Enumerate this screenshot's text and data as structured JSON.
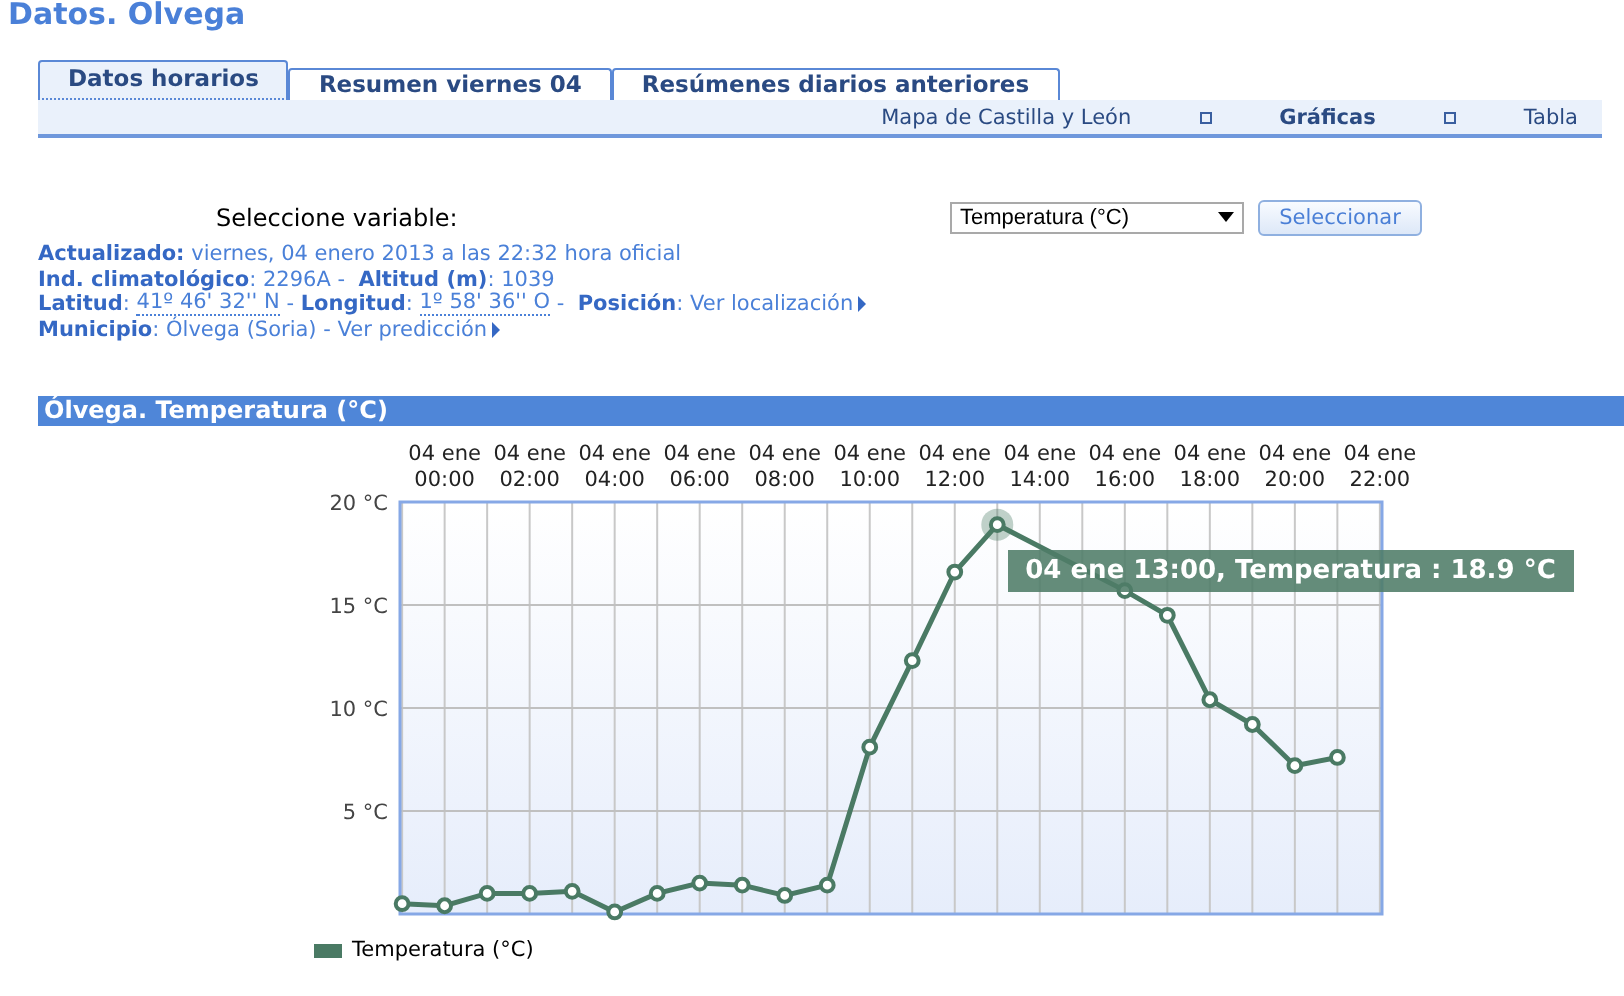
{
  "page_title": "Datos. Olvega",
  "tabs": [
    {
      "label": "Datos horarios",
      "selected": true
    },
    {
      "label": "Resumen viernes 04",
      "selected": false
    },
    {
      "label": "Resúmenes diarios anteriores",
      "selected": false
    }
  ],
  "subnav": [
    {
      "label": "Mapa de Castilla y León",
      "selected": false
    },
    {
      "label": "Gráficas",
      "selected": true
    },
    {
      "label": "Tabla",
      "selected": false
    }
  ],
  "variable_selector": {
    "label": "Seleccione variable:",
    "value": "Temperatura (°C)",
    "button": "Seleccionar"
  },
  "info_lines": [
    [
      {
        "kind": "text",
        "text": "**Actualizado:** viernes, 04 enero 2013 a las 22:32 hora oficial"
      }
    ],
    [
      {
        "kind": "text",
        "text": "**Ind. climatológico**: 2296A -  **Altitud (m)**: 1039"
      }
    ],
    [
      {
        "kind": "text",
        "text": "**Latitud**: "
      },
      {
        "kind": "dotted",
        "text": "41º 46' 32'' N"
      },
      {
        "kind": "text",
        "text": " - **Longitud**: "
      },
      {
        "kind": "dotted",
        "text": "1º 58' 36'' O"
      },
      {
        "kind": "text",
        "text": " -  **Posición**: "
      },
      {
        "kind": "link",
        "text": "Ver localización"
      }
    ],
    [
      {
        "kind": "text",
        "text": "**Municipio**: Ólvega (Soria) - "
      },
      {
        "kind": "link",
        "text": "Ver predicción"
      }
    ]
  ],
  "section_title": "Ólvega. Temperatura (°C)",
  "chart_data": {
    "type": "line",
    "categories": [
      null,
      "04 ene 00:00",
      null,
      "04 ene 02:00",
      null,
      "04 ene 04:00",
      null,
      "04 ene 06:00",
      null,
      "04 ene 08:00",
      null,
      "04 ene 10:00",
      null,
      "04 ene 12:00",
      null,
      "04 ene 14:00",
      null,
      "04 ene 16:00",
      null,
      "04 ene 18:00",
      null,
      "04 ene 20:00",
      null,
      "04 ene 22:00"
    ],
    "series": [
      {
        "name": "Temperatura (°C)",
        "color": "#4a7a64",
        "marker": "circle",
        "values": [
          0.5,
          0.4,
          1.0,
          1.0,
          1.1,
          0.1,
          1.0,
          1.5,
          1.4,
          0.9,
          1.4,
          8.1,
          12.3,
          16.6,
          18.9,
          null,
          null,
          15.7,
          14.5,
          10.4,
          9.2,
          7.2,
          7.6,
          null
        ]
      }
    ],
    "ylim": [
      0,
      20
    ],
    "grid": true,
    "yticks": [
      {
        "value": 5,
        "label": "5 °C"
      },
      {
        "value": 10,
        "label": "10 °C"
      },
      {
        "value": 15,
        "label": "15 °C"
      },
      {
        "value": 20,
        "label": "20 °C"
      }
    ],
    "annotations": [
      "04 ene 13:00, Temperatura : 18.9 °C"
    ]
  }
}
